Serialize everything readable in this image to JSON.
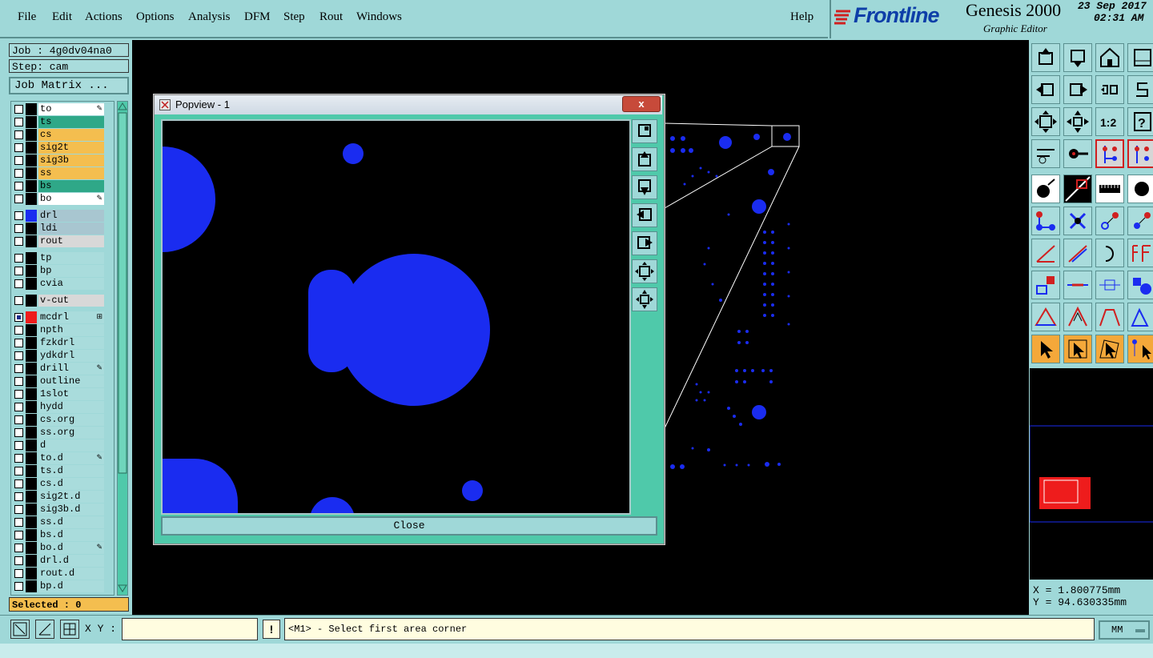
{
  "menu": {
    "items": [
      "File",
      "Edit",
      "Actions",
      "Options",
      "Analysis",
      "DFM",
      "Step",
      "Rout",
      "Windows"
    ],
    "help": "Help"
  },
  "brand": {
    "logo": "Frontline",
    "product": "Genesis 2000",
    "subtitle": "Graphic Editor",
    "date": "23 Sep 2017",
    "time": "02:31 AM"
  },
  "job": {
    "job_label": "Job : 4g0dv04na0",
    "step_label": "Step: cam",
    "matrix_button": "Job Matrix ..."
  },
  "layers": [
    {
      "name": "to",
      "bg": "#ffffff",
      "swatch": "#000000",
      "mark": "edit"
    },
    {
      "name": "ts",
      "bg": "#2fa888",
      "swatch": "#000000",
      "mark": ""
    },
    {
      "name": "cs",
      "bg": "#f4be4f",
      "swatch": "#000000",
      "mark": ""
    },
    {
      "name": "sig2t",
      "bg": "#f4be4f",
      "swatch": "#000000",
      "mark": ""
    },
    {
      "name": "sig3b",
      "bg": "#f4be4f",
      "swatch": "#000000",
      "mark": ""
    },
    {
      "name": "ss",
      "bg": "#f4be4f",
      "swatch": "#000000",
      "mark": ""
    },
    {
      "name": "bs",
      "bg": "#2fa888",
      "swatch": "#000000",
      "mark": ""
    },
    {
      "name": "bo",
      "bg": "#ffffff",
      "swatch": "#000000",
      "mark": "edit"
    },
    {
      "gap": true
    },
    {
      "name": "drl",
      "bg": "#a8c6d0",
      "swatch": "#1a2cf0",
      "mark": ""
    },
    {
      "name": "ldi",
      "bg": "#a8c6d0",
      "swatch": "#000000",
      "mark": ""
    },
    {
      "name": "rout",
      "bg": "#d8d8d8",
      "swatch": "#000000",
      "mark": ""
    },
    {
      "gap": true
    },
    {
      "name": "tp",
      "bg": "#a9dcdc",
      "swatch": "#000000",
      "mark": ""
    },
    {
      "name": "bp",
      "bg": "#a9dcdc",
      "swatch": "#000000",
      "mark": ""
    },
    {
      "name": "cvia",
      "bg": "#a9dcdc",
      "swatch": "#000000",
      "mark": ""
    },
    {
      "gap": true
    },
    {
      "name": "v-cut",
      "bg": "#d8d8d8",
      "swatch": "#000000",
      "mark": ""
    },
    {
      "gap": true
    },
    {
      "name": "mcdrl",
      "bg": "#a9dcdc",
      "swatch": "#ee1c1c",
      "mark": "grid",
      "active": true
    },
    {
      "name": "npth",
      "bg": "#a9dcdc",
      "swatch": "#000000",
      "mark": ""
    },
    {
      "name": "fzkdrl",
      "bg": "#a9dcdc",
      "swatch": "#000000",
      "mark": ""
    },
    {
      "name": "ydkdrl",
      "bg": "#a9dcdc",
      "swatch": "#000000",
      "mark": ""
    },
    {
      "name": "drill",
      "bg": "#a9dcdc",
      "swatch": "#000000",
      "mark": "edit"
    },
    {
      "name": "outline",
      "bg": "#a9dcdc",
      "swatch": "#000000",
      "mark": ""
    },
    {
      "name": "1slot",
      "bg": "#a9dcdc",
      "swatch": "#000000",
      "mark": ""
    },
    {
      "name": "hydd",
      "bg": "#a9dcdc",
      "swatch": "#000000",
      "mark": ""
    },
    {
      "name": "cs.org",
      "bg": "#a9dcdc",
      "swatch": "#000000",
      "mark": ""
    },
    {
      "name": "ss.org",
      "bg": "#a9dcdc",
      "swatch": "#000000",
      "mark": ""
    },
    {
      "name": "d",
      "bg": "#a9dcdc",
      "swatch": "#000000",
      "mark": ""
    },
    {
      "name": "to.d",
      "bg": "#a9dcdc",
      "swatch": "#000000",
      "mark": "edit"
    },
    {
      "name": "ts.d",
      "bg": "#a9dcdc",
      "swatch": "#000000",
      "mark": ""
    },
    {
      "name": "cs.d",
      "bg": "#a9dcdc",
      "swatch": "#000000",
      "mark": ""
    },
    {
      "name": "sig2t.d",
      "bg": "#a9dcdc",
      "swatch": "#000000",
      "mark": ""
    },
    {
      "name": "sig3b.d",
      "bg": "#a9dcdc",
      "swatch": "#000000",
      "mark": ""
    },
    {
      "name": "ss.d",
      "bg": "#a9dcdc",
      "swatch": "#000000",
      "mark": ""
    },
    {
      "name": "bs.d",
      "bg": "#a9dcdc",
      "swatch": "#000000",
      "mark": ""
    },
    {
      "name": "bo.d",
      "bg": "#a9dcdc",
      "swatch": "#000000",
      "mark": "edit"
    },
    {
      "name": "drl.d",
      "bg": "#a9dcdc",
      "swatch": "#000000",
      "mark": ""
    },
    {
      "name": "rout.d",
      "bg": "#a9dcdc",
      "swatch": "#000000",
      "mark": ""
    },
    {
      "name": "bp.d",
      "bg": "#a9dcdc",
      "swatch": "#000000",
      "mark": ""
    }
  ],
  "selected": "Selected : 0",
  "popview": {
    "title": "Popview - 1",
    "close_x": "x",
    "close_button": "Close"
  },
  "coords": {
    "x": "X = 1.800775mm",
    "y": "Y = 94.630335mm"
  },
  "bottom": {
    "xy_label": "X Y :",
    "xy_value": "",
    "warn": "!",
    "prompt": "<M1> - Select first area corner",
    "units": "MM"
  },
  "colors": {
    "pad_blue": "#1a2cf0",
    "panel_teal": "#9fd8d8",
    "tool_green": "#4fc9aa",
    "highlight_red": "#ee1c1c"
  }
}
